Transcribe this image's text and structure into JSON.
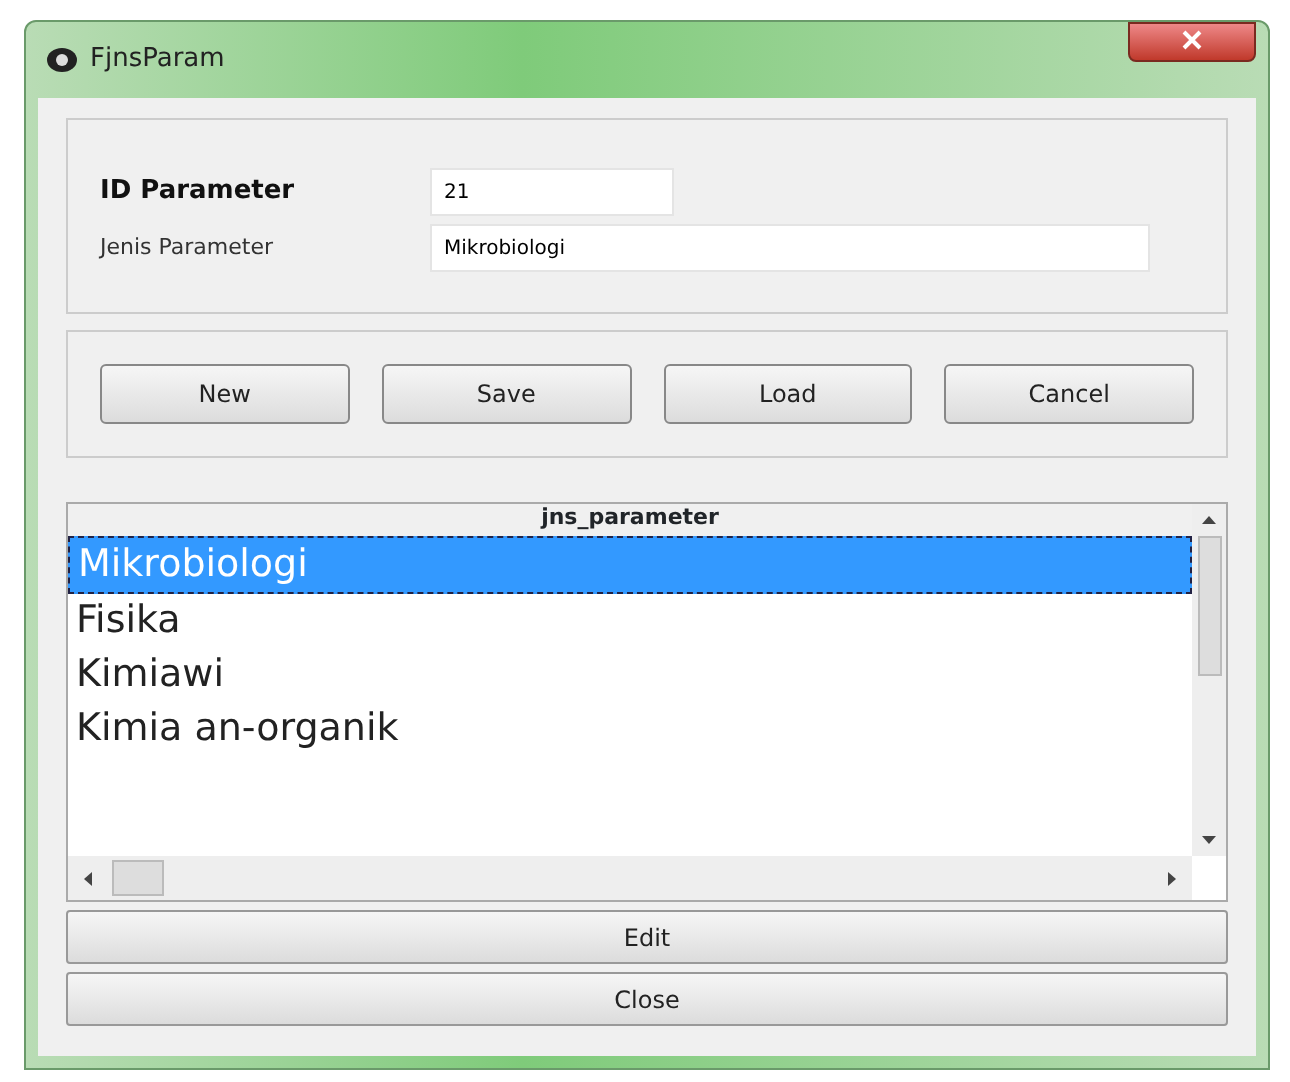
{
  "window": {
    "title": "FjnsParam"
  },
  "form": {
    "fields": [
      {
        "label": "ID Parameter",
        "value": "21",
        "bold": true,
        "wide": false
      },
      {
        "label": "Jenis Parameter",
        "value": "Mikrobiologi",
        "bold": false,
        "wide": true
      }
    ]
  },
  "buttons": [
    "New",
    "Save",
    "Load",
    "Cancel"
  ],
  "list": {
    "header": "jns_parameter",
    "items": [
      {
        "label": "Mikrobiologi",
        "selected": true
      },
      {
        "label": "Fisika",
        "selected": false
      },
      {
        "label": "Kimiawi",
        "selected": false
      },
      {
        "label": "Kimia an-organik",
        "selected": false
      }
    ]
  },
  "bottom_buttons": [
    "Edit",
    "Close"
  ]
}
